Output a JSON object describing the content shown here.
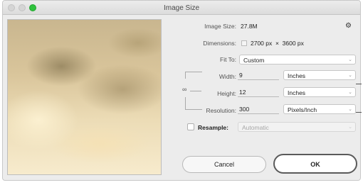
{
  "window": {
    "title": "Image Size"
  },
  "image_size": {
    "label": "Image Size:",
    "value": "27.8M"
  },
  "dimensions": {
    "label": "Dimensions:",
    "value": "2700 px  ×  3600 px"
  },
  "fit_to": {
    "label": "Fit To:",
    "value": "Custom"
  },
  "width": {
    "label": "Width:",
    "value": "9",
    "unit": "Inches"
  },
  "height": {
    "label": "Height:",
    "value": "12",
    "unit": "Inches"
  },
  "resolution": {
    "label": "Resolution:",
    "value": "300",
    "unit": "Pixels/Inch"
  },
  "resample": {
    "label": "Resample:",
    "value": "Automatic",
    "checked": false
  },
  "buttons": {
    "cancel": "Cancel",
    "ok": "OK"
  },
  "icons": {
    "gear": "gear-icon",
    "chain": "chain-link-icon",
    "chevron": "chevron-down-icon"
  },
  "colors": {
    "zoom_button": "#2fc23d",
    "window_bg": "#ececec"
  }
}
